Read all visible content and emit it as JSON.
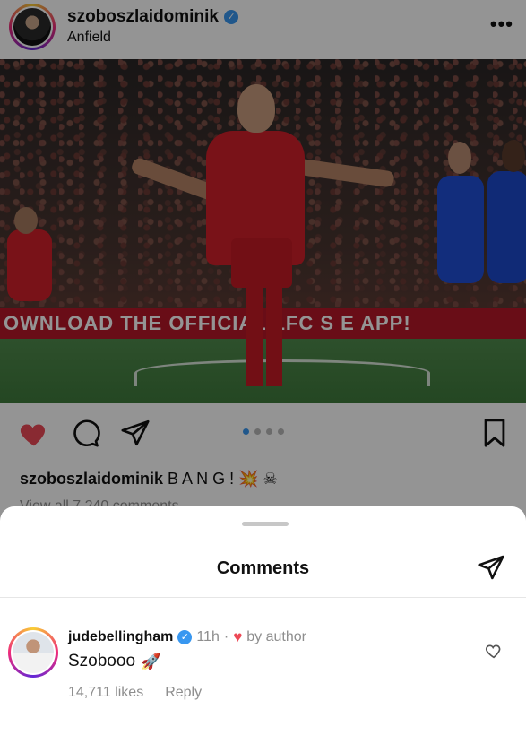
{
  "post": {
    "username": "szoboszlaidominik",
    "location": "Anfield",
    "more_glyph": "•••",
    "ad_board_text": "OWNLOAD THE OFFICIAL LFC S  E APP!",
    "caption_user": "szoboszlaidominik",
    "caption_text": "B A N G ! 💥 ☠",
    "view_all": "View all 7,240 comments",
    "carousel": {
      "count": 4,
      "active": 0
    }
  },
  "icons": {
    "verified": "verified-badge-icon",
    "like": "heart-filled-icon",
    "comment": "comment-bubble-icon",
    "share": "paper-plane-icon",
    "save": "bookmark-icon"
  },
  "comments_sheet": {
    "title": "Comments",
    "comment": {
      "username": "judebellingham",
      "time": "11h",
      "separator": "·",
      "by_author": "by author",
      "text": "Szobooo",
      "emoji": "🚀",
      "likes": "14,711 likes",
      "reply": "Reply"
    }
  },
  "colors": {
    "like_red": "#ed4956",
    "verified_blue": "#3897f0",
    "secondary_text": "#8e8e8e"
  }
}
